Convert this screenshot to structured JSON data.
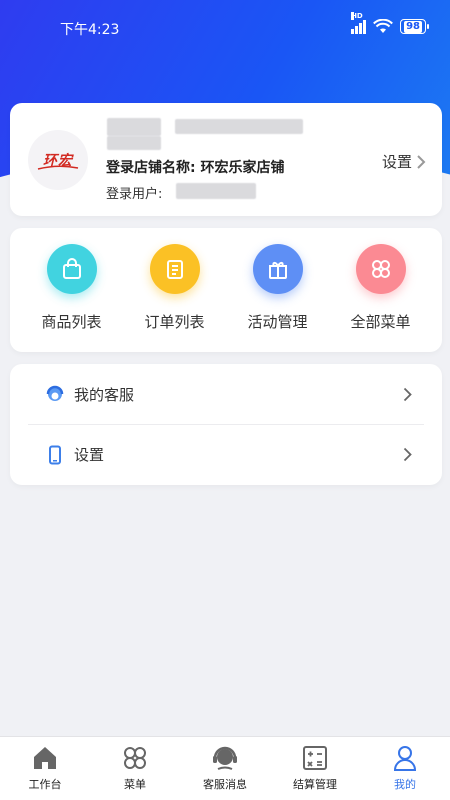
{
  "status_bar": {
    "time": "下午4:23",
    "network": "HD",
    "battery": "98"
  },
  "profile": {
    "logo_text": "环宏",
    "shop_name_label": "登录店铺名称:",
    "shop_name": "环宏乐家店铺",
    "login_user_label": "登录用户:",
    "settings_label": "设置"
  },
  "quick_menu": [
    {
      "label": "商品列表",
      "icon": "shopping-bag-icon",
      "color": "#41d3e0"
    },
    {
      "label": "订单列表",
      "icon": "clipboard-icon",
      "color": "#fbc125"
    },
    {
      "label": "活动管理",
      "icon": "gift-icon",
      "color": "#5e8ff5"
    },
    {
      "label": "全部菜单",
      "icon": "grid-flower-icon",
      "color": "#fb8a93"
    }
  ],
  "list": [
    {
      "label": "我的客服",
      "icon": "customer-service-icon"
    },
    {
      "label": "设置",
      "icon": "phone-icon"
    }
  ],
  "tabbar": [
    {
      "label": "工作台",
      "icon": "home-icon"
    },
    {
      "label": "菜单",
      "icon": "menu-grid-icon"
    },
    {
      "label": "客服消息",
      "icon": "headset-icon"
    },
    {
      "label": "结算管理",
      "icon": "calculator-icon"
    },
    {
      "label": "我的",
      "icon": "user-icon",
      "active": true
    }
  ],
  "colors": {
    "primary": "#1a56f5",
    "active_tab": "#3775e8",
    "background": "#f0f1f5"
  }
}
